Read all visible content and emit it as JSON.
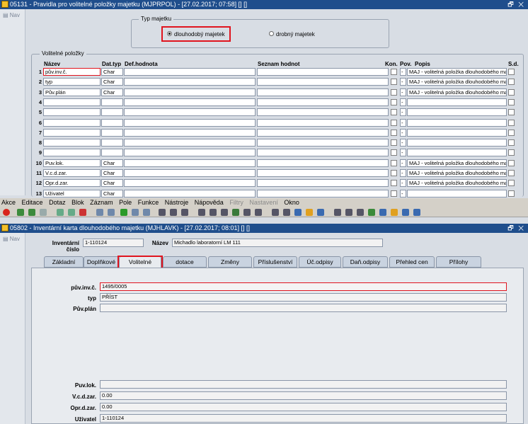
{
  "win1": {
    "title": "05131 - Pravidla pro volitelné položky majetku (MJPRPOL) - [27.02.2017; 07:58] [] []",
    "ctl": "🗗 ✕",
    "nav": "Nav",
    "typ_group": "Typ majetku",
    "radio_1": "dlouhodobý majetek",
    "radio_2": "drobný majetek",
    "vol_group": "Volitelné položky",
    "headers": {
      "nazev": "Název",
      "dattyp": "Dat.typ",
      "defh": "Def.hodnota",
      "seznam": "Seznam hodnot",
      "kon": "Kon.",
      "pov": "Pov.",
      "popis": "Popis",
      "sd": "S.d."
    },
    "rows": [
      {
        "n": "1",
        "nazev": "pův.inv.č.",
        "typ": "Char",
        "pov": "-",
        "popis": "MAJ - volitelná položka dlouhodobého majetku"
      },
      {
        "n": "2",
        "nazev": "typ",
        "typ": "Char",
        "pov": "-",
        "popis": "MAJ - volitelná položka dlouhodobého majetku"
      },
      {
        "n": "3",
        "nazev": "Pův.plán",
        "typ": "Char",
        "pov": "-",
        "popis": "MAJ - volitelná položka dlouhodobého majetku"
      },
      {
        "n": "4",
        "nazev": "",
        "typ": "",
        "pov": "-",
        "popis": ""
      },
      {
        "n": "5",
        "nazev": "",
        "typ": "",
        "pov": "-",
        "popis": ""
      },
      {
        "n": "6",
        "nazev": "",
        "typ": "",
        "pov": "-",
        "popis": ""
      },
      {
        "n": "7",
        "nazev": "",
        "typ": "",
        "pov": "-",
        "popis": ""
      },
      {
        "n": "8",
        "nazev": "",
        "typ": "",
        "pov": "-",
        "popis": ""
      },
      {
        "n": "9",
        "nazev": "",
        "typ": "",
        "pov": "-",
        "popis": ""
      },
      {
        "n": "10",
        "nazev": "Puv.lok.",
        "typ": "Char",
        "pov": "-",
        "popis": "MAJ - volitelná položka dlouhodobého majetku"
      },
      {
        "n": "11",
        "nazev": "V.c.d.zar.",
        "typ": "Char",
        "pov": "-",
        "popis": "MAJ - volitelná položka dlouhodobého majetku"
      },
      {
        "n": "12",
        "nazev": "Opr.d.zar.",
        "typ": "Char",
        "pov": "-",
        "popis": "MAJ - volitelná položka dlouhodobého majetku"
      },
      {
        "n": "13",
        "nazev": "Uživatel",
        "typ": "Char",
        "pov": "-",
        "popis": ""
      }
    ]
  },
  "menu": [
    "Akce",
    "Editace",
    "Dotaz",
    "Blok",
    "Záznam",
    "Pole",
    "Funkce",
    "Nástroje",
    "Nápověda",
    "Filtry",
    "Nastavení",
    "Okno"
  ],
  "win2": {
    "title": "05802 - Inventární karta dlouhodobého majetku (MJHLAVK) - [27.02.2017; 08:01] [] []",
    "ctl": "🗗 ✕",
    "nav": "Nav",
    "inv_label": "Inventární číslo",
    "inv_value": "1-110124",
    "name_label": "Název",
    "name_value": "Michadlo laboratorní LM 111",
    "tabs": [
      "Základní",
      "Doplňkové",
      "Volitelné",
      "dotace",
      "Změny",
      "Příslušenství",
      "Úč.odpisy",
      "Daň.odpisy",
      "Přehled cen",
      "Přílohy"
    ],
    "fields_top": [
      {
        "label": "pův.inv.č.",
        "value": "1495/0005"
      },
      {
        "label": "typ",
        "value": "PŘÍST"
      },
      {
        "label": "Pův.plán",
        "value": ""
      }
    ],
    "fields_bottom": [
      {
        "label": "Puv.lok.",
        "value": ""
      },
      {
        "label": "V.c.d.zar.",
        "value": "0.00"
      },
      {
        "label": "Opr.d.zar.",
        "value": "0.00"
      },
      {
        "label": "Uživatel",
        "value": "1-110124"
      }
    ]
  },
  "colors": {
    "titlebar": "#1f4e8c",
    "highlight": "#e0141e"
  }
}
